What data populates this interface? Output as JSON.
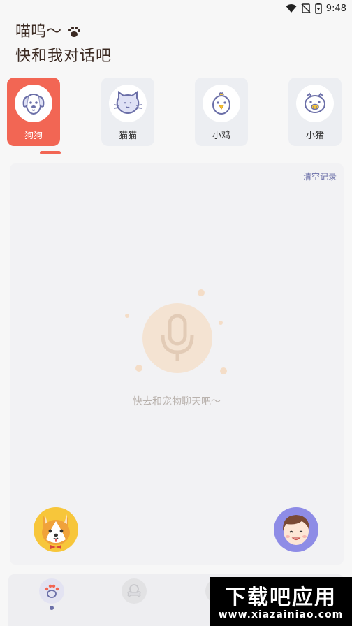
{
  "status_bar": {
    "time": "9:48"
  },
  "greeting": {
    "line1": "喵呜～",
    "line2": "快和我对话吧"
  },
  "pets": [
    {
      "label": "狗狗",
      "icon": "dog-icon",
      "active": true
    },
    {
      "label": "猫猫",
      "icon": "cat-icon",
      "active": false
    },
    {
      "label": "小鸡",
      "icon": "chick-icon",
      "active": false
    },
    {
      "label": "小猪",
      "icon": "pig-icon",
      "active": false
    }
  ],
  "chat": {
    "clear_label": "清空记录",
    "empty_text": "快去和宠物聊天吧～",
    "mic_icon": "microphone-icon"
  },
  "tabs": [
    {
      "icon": "paw-icon",
      "active": true
    },
    {
      "icon": "bone-icon",
      "active": false
    },
    {
      "icon": "tab-icon",
      "active": false
    },
    {
      "icon": "tab-icon",
      "active": false
    }
  ],
  "watermark": {
    "title": "下载吧应用",
    "url": "www.xiazainiao.com"
  },
  "colors": {
    "accent": "#f26654",
    "link": "#6b6fa8",
    "dog_bg": "#f7c63a",
    "user_bg": "#8e8ce6"
  }
}
